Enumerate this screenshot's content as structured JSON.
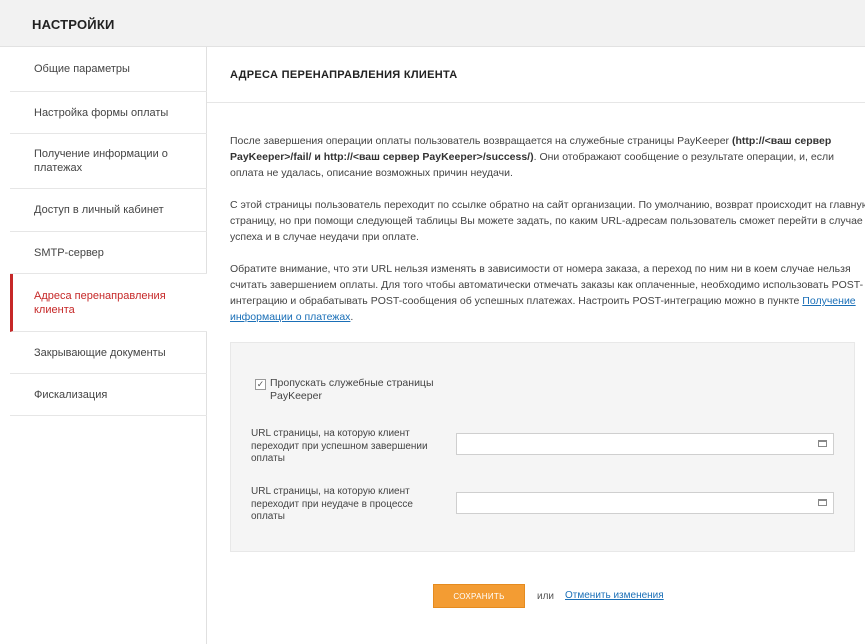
{
  "header": {
    "title": "НАСТРОЙКИ"
  },
  "sidebar": {
    "items": [
      {
        "label": "Общие параметры"
      },
      {
        "label": "Настройка формы оплаты"
      },
      {
        "label": "Получение информации о платежах"
      },
      {
        "label": "Доступ в личный кабинет"
      },
      {
        "label": "SMTP-сервер"
      },
      {
        "label": "Адреса перенаправления клиента",
        "active": true
      },
      {
        "label": "Закрывающие документы"
      },
      {
        "label": "Фискализация"
      }
    ]
  },
  "main": {
    "title": "АДРЕСА ПЕРЕНАПРАВЛЕНИЯ КЛИЕНТА",
    "p1": {
      "a": "После завершения операции оплаты пользователь возвращается на служебные страницы PayKeeper ",
      "b": "(http://<ваш сервер PayKeeper>/fail/ и http://<ваш сервер PayKeeper>/success/)",
      "c": ". Они отображают сообщение о результате операции, и, если оплата не удалась, описание возможных причин неудачи."
    },
    "p2": "С этой страницы пользователь переходит по ссылке обратно на сайт организации. По умолчанию, возврат происходит на главную страницу, но при помощи следующей таблицы Вы можете задать, по каким URL-адресам пользователь сможет перейти в случае успеха и в случае неудачи при оплате.",
    "p3": {
      "text": "Обратите внимание, что эти URL нельзя изменять в зависимости от номера заказа, а переход по ним ни в коем случае нельзя считать завершением оплаты. Для того чтобы автоматически отмечать заказы как оплаченные, необходимо использовать POST-интеграцию и обрабатывать POST-сообщения об успешных платежах. Настроить POST-интеграцию можно в пункте ",
      "link": "Получение информации о платежах",
      "end": "."
    },
    "form": {
      "skip_checkbox": {
        "label": "Пропускать служебные страницы PayKeeper",
        "checked": true,
        "mark": "✓"
      },
      "success_url": {
        "label": "URL страницы, на которую клиент переходит при успешном завершении оплаты",
        "value": ""
      },
      "fail_url": {
        "label": "URL страницы, на которую клиент переходит при неудаче в процессе оплаты",
        "value": ""
      }
    },
    "actions": {
      "save": "СОХРАНИТЬ",
      "or": "или",
      "cancel": "Отменить изменения"
    }
  },
  "colors": {
    "accent": "#c62828",
    "button": "#f39c33",
    "link": "#1a6fb7"
  },
  "icons": {
    "input_icon": "list-box-icon"
  }
}
